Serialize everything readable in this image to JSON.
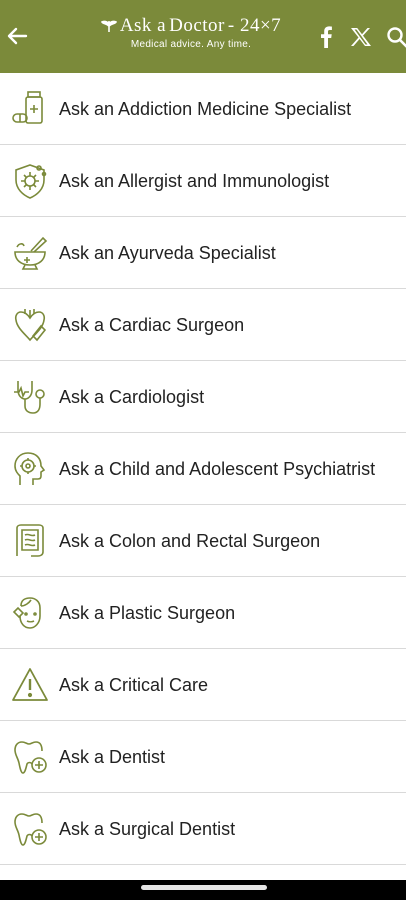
{
  "colors": {
    "header_bg": "#7b8a3a",
    "icon_color": "#7b8a3a",
    "divider": "#d9d9d9"
  },
  "header": {
    "logo_prefix": "Ask a",
    "logo_name": "Doctor",
    "logo_suffix": "- 24×7",
    "tagline": "Medical advice. Any time.",
    "icons": [
      "back-arrow-icon",
      "facebook-icon",
      "x-icon",
      "search-icon"
    ]
  },
  "specialists": [
    {
      "label": "Ask an Addiction Medicine Specialist",
      "icon": "pill-bottle-icon"
    },
    {
      "label": "Ask an Allergist and Immunologist",
      "icon": "shield-virus-icon"
    },
    {
      "label": "Ask an Ayurveda Specialist",
      "icon": "mortar-pestle-icon"
    },
    {
      "label": "Ask a Cardiac Surgeon",
      "icon": "heart-surgery-icon"
    },
    {
      "label": "Ask a Cardiologist",
      "icon": "stethoscope-icon"
    },
    {
      "label": "Ask a Child and Adolescent Psychiatrist",
      "icon": "child-mind-icon"
    },
    {
      "label": "Ask a Colon and Rectal Surgeon",
      "icon": "intestine-icon"
    },
    {
      "label": "Ask a Plastic Surgeon",
      "icon": "face-surgery-icon"
    },
    {
      "label": "Ask a Critical Care",
      "icon": "warning-triangle-icon"
    },
    {
      "label": "Ask a Dentist",
      "icon": "tooth-icon"
    },
    {
      "label": "Ask a Surgical Dentist",
      "icon": "surgical-tooth-icon"
    }
  ]
}
